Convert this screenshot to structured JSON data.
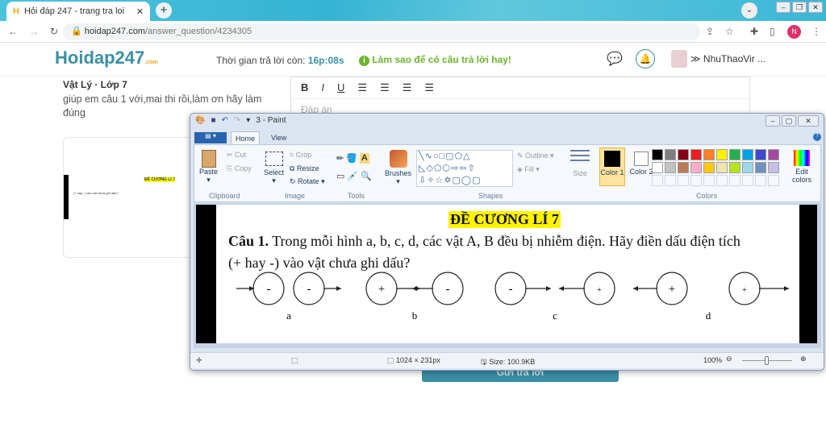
{
  "browser": {
    "tab_title": "Hỏi đáp 247 - trang tra loi",
    "url_domain": "hoidap247.com",
    "url_path": "/answer_question/4234305",
    "profile_initial": "N"
  },
  "site": {
    "logo": "Hoidap247",
    "logo_sub": ".com",
    "timer_label": "Thời gian trả lời còn:",
    "timer_value": "16p:08s",
    "tip": "Làm sao để có câu trả lời hay!",
    "username": "NhuThaoVir ..."
  },
  "question": {
    "subject": "Vật Lý · Lớp 7",
    "text": "giúp em câu 1 với,mai thi rồi,làm ơn hãy làm đúng"
  },
  "editor": {
    "buttons": [
      "B",
      "I",
      "U"
    ],
    "placeholder": "Đáp án"
  },
  "paint": {
    "title": "3 - Paint",
    "tabs": [
      "Home",
      "View"
    ],
    "clipboard": {
      "paste": "Paste",
      "cut": "Cut",
      "copy": "Copy",
      "label": "Clipboard"
    },
    "image": {
      "select": "Select",
      "crop": "Crop",
      "resize": "Resize",
      "rotate": "Rotate",
      "label": "Image"
    },
    "tools_label": "Tools",
    "brushes": "Brushes",
    "shapes_label": "Shapes",
    "outline": "Outline",
    "fill": "Fill",
    "size": "Size",
    "color1": "Color 1",
    "color2": "Color 2",
    "colors_label": "Colors",
    "edit_colors": "Edit colors",
    "palette": [
      "#000000",
      "#7f7f7f",
      "#880015",
      "#ed1c24",
      "#ff7f27",
      "#fff200",
      "#22b14c",
      "#00a2e8",
      "#3f48cc",
      "#a349a4",
      "#ffffff",
      "#c3c3c3",
      "#b97a57",
      "#ffaec9",
      "#ffc90e",
      "#efe4b0",
      "#b5e61d",
      "#99d9ea",
      "#7092be",
      "#c8bfe7"
    ],
    "status": {
      "dimensions": "1024 × 231px",
      "size": "Size: 100.9KB",
      "zoom": "100%"
    },
    "zoom_percent": 100
  },
  "document": {
    "heading": "ĐỀ CƯƠNG LÍ 7",
    "q_bold": "Câu 1.",
    "q_text": " Trong mỗi hình a, b, c, d, các vật A, B đều bị nhiễm điện. Hãy điền dấu điện tích",
    "q_text2": "(+ hay -) vào vật chưa ghi dấu?",
    "figures": [
      {
        "label": "a",
        "signs": [
          "-",
          "-"
        ]
      },
      {
        "label": "b",
        "signs": [
          "+",
          "-"
        ]
      },
      {
        "label": "c",
        "signs": [
          "-",
          "+"
        ]
      },
      {
        "label": "d",
        "signs": [
          "+",
          "+"
        ]
      }
    ]
  },
  "submit_button": "Gửi trả lời"
}
